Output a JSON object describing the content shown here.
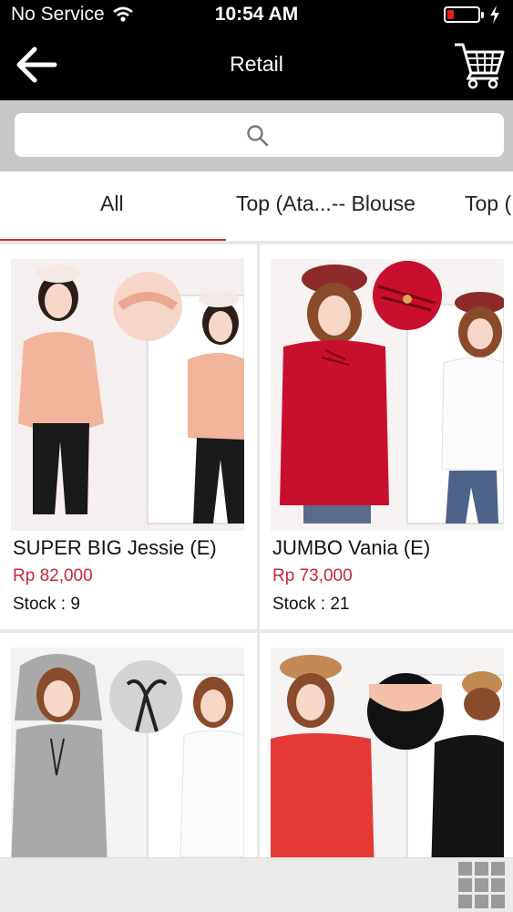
{
  "status": {
    "carrier": "No Service",
    "time": "10:54 AM",
    "battery_level": 0.22,
    "icons": [
      "wifi-icon",
      "battery-icon",
      "charging-icon"
    ]
  },
  "nav": {
    "title": "Retail",
    "back_icon": "back-arrow-icon",
    "cart_icon": "shopping-cart-icon"
  },
  "search": {
    "placeholder": "",
    "value": "",
    "icon": "search-icon"
  },
  "tabs": [
    {
      "label": "All",
      "active": true
    },
    {
      "label": "Top (Ata...-- Blouse",
      "active": false
    },
    {
      "label": "Top (",
      "active": false
    }
  ],
  "products": [
    {
      "name": "SUPER BIG Jessie (E)",
      "price": "Rp 82,000",
      "stock": "Stock : 9",
      "color": "#f2b49a"
    },
    {
      "name": "JUMBO Vania (E)",
      "price": "Rp 73,000",
      "stock": "Stock : 21",
      "color": "#c8102e"
    },
    {
      "name": "",
      "price": "",
      "stock": "",
      "color": "#a9a9a9"
    },
    {
      "name": "",
      "price": "",
      "stock": "",
      "color": "#e53935"
    }
  ],
  "bottom": {
    "icon": "grid-view-icon"
  },
  "colors": {
    "accent": "#d32f2f",
    "price": "#c62839",
    "bar": "#000000"
  }
}
